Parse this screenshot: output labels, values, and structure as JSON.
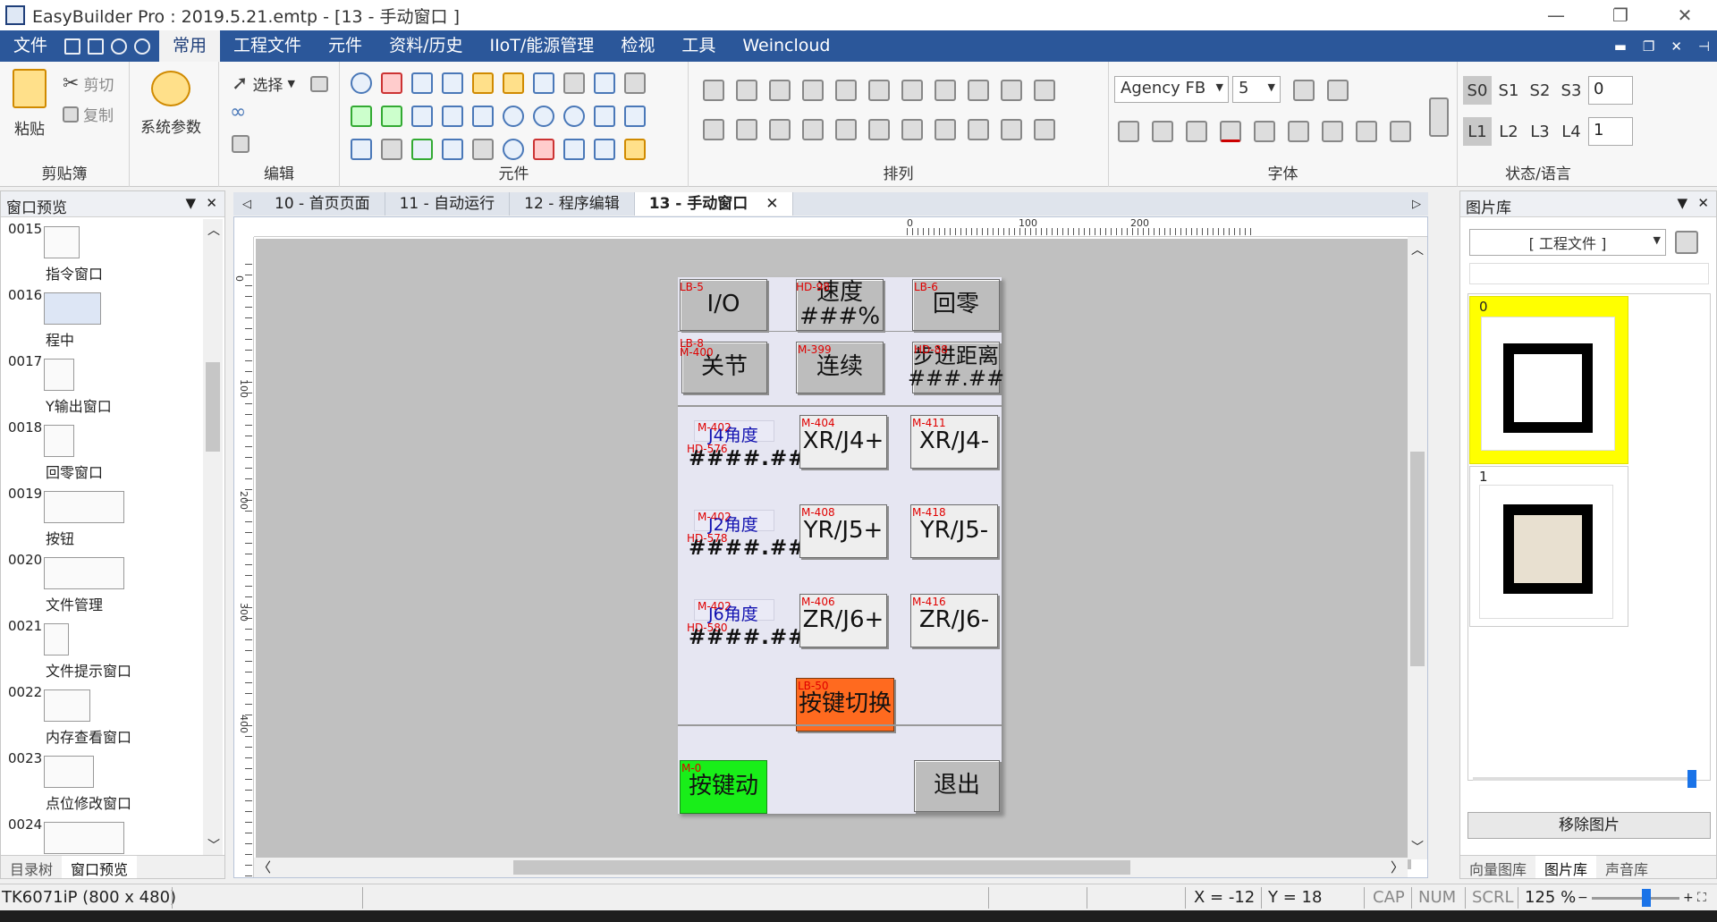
{
  "window": {
    "title": "EasyBuilder Pro : 2019.5.21.emtp - [13 - 手动窗口 ]",
    "min_glyph": "—",
    "max_glyph": "❐",
    "close_glyph": "✕"
  },
  "menu": {
    "items": [
      "文件",
      "常用",
      "工程文件",
      "元件",
      "资料/历史",
      "IIoT/能源管理",
      "检视",
      "工具",
      "Weincloud"
    ],
    "active": "常用",
    "mdi": [
      "▬",
      "❐",
      "✕",
      "⊣"
    ]
  },
  "ribbon": {
    "clipboard": {
      "label": "剪贴簿",
      "paste": "粘贴",
      "cut": "剪切",
      "copy": "复制"
    },
    "sys": {
      "label": "系统参数"
    },
    "edit": {
      "label": "编辑",
      "select": "选择"
    },
    "elements": {
      "label": "元件"
    },
    "arrange": {
      "label": "排列"
    },
    "font": {
      "label": "字体",
      "family": "Agency FB",
      "size": "5"
    },
    "state": {
      "label": "状态/语言",
      "s": [
        "S0",
        "S1",
        "S2",
        "S3"
      ],
      "s_value": "0",
      "l": [
        "L1",
        "L2",
        "L3",
        "L4"
      ],
      "l_value": "1"
    }
  },
  "left_panel": {
    "title": "窗口预览",
    "items": [
      {
        "num": "0015",
        "label": "指令窗口"
      },
      {
        "num": "0016",
        "label": "程中"
      },
      {
        "num": "0017",
        "label": "Y输出窗口"
      },
      {
        "num": "0018",
        "label": "回零窗口"
      },
      {
        "num": "0019",
        "label": "按钮"
      },
      {
        "num": "0020",
        "label": "文件管理"
      },
      {
        "num": "0021",
        "label": "文件提示窗口"
      },
      {
        "num": "0022",
        "label": "内存查看窗口"
      },
      {
        "num": "0023",
        "label": "点位修改窗口"
      },
      {
        "num": "0024",
        "label": ""
      }
    ],
    "tabs": [
      "目录树",
      "窗口预览"
    ]
  },
  "doc_tabs": [
    "10 - 首页页面",
    "11 - 自动运行",
    "12 - 程序编辑",
    "13 - 手动窗口"
  ],
  "ruler": {
    "h": [
      "0",
      "100",
      "200"
    ],
    "v": [
      "0",
      "100",
      "200",
      "300",
      "400"
    ]
  },
  "hmi": {
    "row1": [
      {
        "tag": "LB-5",
        "text": "I/O"
      },
      {
        "tag": "HD-98",
        "text": "速度\n###%"
      },
      {
        "tag": "LB-6",
        "text": "回零"
      }
    ],
    "row2": [
      {
        "tag": "LB-8",
        "tag2": "M-400",
        "text": "关节"
      },
      {
        "tag": "M-399",
        "text": "连续"
      },
      {
        "tag": "HD-88",
        "text": "步进距离\n###.##"
      }
    ],
    "axes": [
      {
        "mtag": "M-402",
        "label": "J4角度",
        "hdtag": "HD-576",
        "value": "####.###",
        "plus_tag": "M-404",
        "plus": "XR/J4+",
        "minus_tag": "M-411",
        "minus": "XR/J4-"
      },
      {
        "mtag": "M-402",
        "label": "J2角度",
        "hdtag": "HD-578",
        "value": "####.###",
        "plus_tag": "M-408",
        "plus": "YR/J5+",
        "minus_tag": "M-418",
        "minus": "YR/J5-"
      },
      {
        "mtag": "M-402",
        "label": "J6角度",
        "hdtag": "HD-580",
        "value": "####.###",
        "plus_tag": "M-406",
        "plus": "ZR/J6+",
        "minus_tag": "M-416",
        "minus": "ZR/J6-"
      }
    ],
    "switch": {
      "tag": "LB-50",
      "text": "按键切换"
    },
    "jog": {
      "tag": "M-0",
      "text": "按键动"
    },
    "exit": {
      "text": "退出"
    }
  },
  "gallery": {
    "title": "图片库",
    "source": "[ 工程文件 ]",
    "items": [
      "0",
      "1"
    ],
    "remove": "移除图片",
    "tabs": [
      "向量图库",
      "图片库",
      "声音库"
    ]
  },
  "status": {
    "device": "TK6071iP (800 x 480)",
    "x": "X = -12",
    "y": "Y = 18",
    "cap": "CAP",
    "num": "NUM",
    "scrl": "SCRL",
    "zoom": "125 %"
  },
  "colors": {
    "ribbon_blue": "#2b579a",
    "switch_orange": "#ff6a1f",
    "jog_green": "#19ee19",
    "gallery_selected": "#ffff00",
    "tag_red": "#e00000",
    "label_blue": "#1010b0"
  }
}
